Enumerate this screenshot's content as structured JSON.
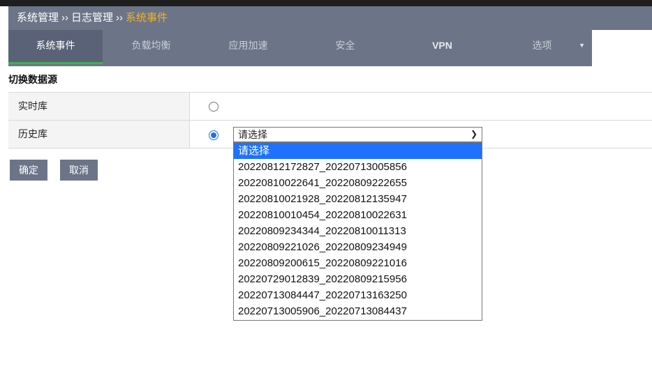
{
  "breadcrumb": [
    "系统管理",
    "日志管理",
    "系统事件"
  ],
  "breadcrumb_sep": "››",
  "tabs": [
    {
      "label": "系统事件",
      "active": true
    },
    {
      "label": "负载均衡"
    },
    {
      "label": "应用加速"
    },
    {
      "label": "安全"
    },
    {
      "label": "VPN"
    },
    {
      "label": "选项",
      "has_dropdown": true
    }
  ],
  "section_title": "切换数据源",
  "rows": [
    {
      "label": "实时库",
      "selected": false
    },
    {
      "label": "历史库",
      "selected": true
    }
  ],
  "select": {
    "value": "请选择",
    "options": [
      "请选择",
      "20220812172827_20220713005856",
      "20220810022641_20220809222655",
      "20220810021928_20220812135947",
      "20220810010454_20220810022631",
      "20220809234344_20220810011313",
      "20220809221026_20220809234949",
      "20220809200615_20220809221016",
      "20220729012839_20220809215956",
      "20220713084447_20220713163250",
      "20220713005906_20220713084437"
    ]
  },
  "buttons": {
    "confirm": "确定",
    "cancel": "取消"
  },
  "colors": {
    "header": "#6c7587",
    "active_tab_underline": "#3fb24b",
    "breadcrumb_current": "#f5b020",
    "selected_option": "#1e72ff",
    "radio_checked": "#1a73e8"
  },
  "icons": {
    "dropdown_chevron": "chevron-down-icon",
    "tab_arrow": "caret-down-icon"
  }
}
